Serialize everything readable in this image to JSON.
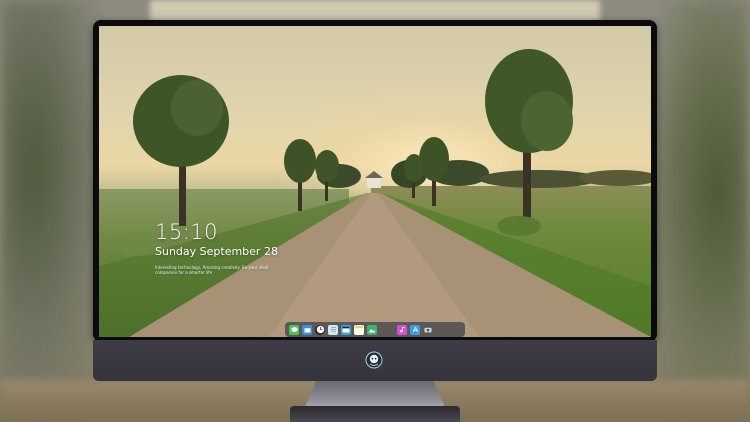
{
  "lock_screen": {
    "time": "15:10",
    "date": "Sunday September 28",
    "tagline": "Interesting technology, Amazing creativity. Be your ideal companion for a smarter life"
  },
  "dock": {
    "icons": [
      {
        "name": "messages-icon",
        "color": "#4cc35a"
      },
      {
        "name": "folder-icon",
        "color": "#3a8ee6"
      },
      {
        "name": "clock-icon",
        "color": "#f2f2f2"
      },
      {
        "name": "notes-list-icon",
        "color": "#6fa8d8"
      },
      {
        "name": "clapperboard-icon",
        "color": "#2fa7e0"
      },
      {
        "name": "notes-icon",
        "color": "#f5d64a"
      },
      {
        "name": "photos-icon",
        "color": "#3db36b"
      },
      {
        "name": "music-icon",
        "color": "#d94fd4"
      },
      {
        "name": "app-store-icon",
        "color": "#3b9bf0"
      },
      {
        "name": "camera-icon",
        "color": "#55585f"
      }
    ]
  },
  "colors": {
    "bezel": "#0b0b0d",
    "chin": "#3e3d47",
    "dock_bg": "rgba(60,62,70,0.72)"
  }
}
